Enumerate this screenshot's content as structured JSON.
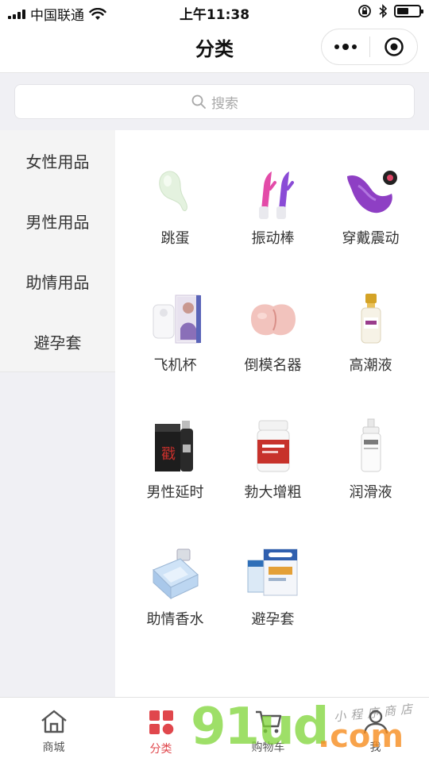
{
  "status_bar": {
    "carrier": "中国联通",
    "time": "上午11:38",
    "battery_level": 0.55
  },
  "nav": {
    "title": "分类"
  },
  "search": {
    "placeholder": "搜索"
  },
  "sidebar": {
    "items": [
      {
        "label": "女性用品"
      },
      {
        "label": "男性用品"
      },
      {
        "label": "助情用品"
      },
      {
        "label": "避孕套"
      }
    ]
  },
  "categories": [
    {
      "label": "跳蛋",
      "icon": "egg-vibrator-image"
    },
    {
      "label": "振动棒",
      "icon": "vibrator-wand-image"
    },
    {
      "label": "穿戴震动",
      "icon": "wearable-vibrator-image"
    },
    {
      "label": "飞机杯",
      "icon": "masturbation-cup-image"
    },
    {
      "label": "倒模名器",
      "icon": "mold-toy-image"
    },
    {
      "label": "高潮液",
      "icon": "climax-liquid-bottle-image"
    },
    {
      "label": "男性延时",
      "icon": "delay-spray-image"
    },
    {
      "label": "勃大增粗",
      "icon": "supplement-bottle-image"
    },
    {
      "label": "润滑液",
      "icon": "lubricant-bottle-image"
    },
    {
      "label": "助情香水",
      "icon": "perfume-bottle-image"
    },
    {
      "label": "避孕套",
      "icon": "condom-box-image"
    }
  ],
  "tabbar": {
    "items": [
      {
        "label": "商城",
        "icon": "home-icon"
      },
      {
        "label": "分类",
        "icon": "category-icon"
      },
      {
        "label": "购物车",
        "icon": "cart-icon"
      },
      {
        "label": "我",
        "icon": "user-icon"
      }
    ],
    "active_index": 1
  },
  "watermark": {
    "brand": "91ud",
    "suffix": ".com",
    "tagline": "小程序商店"
  },
  "colors": {
    "accent": "#e0474c",
    "watermark_green": "#7ed436",
    "watermark_orange": "#f68c1e"
  }
}
